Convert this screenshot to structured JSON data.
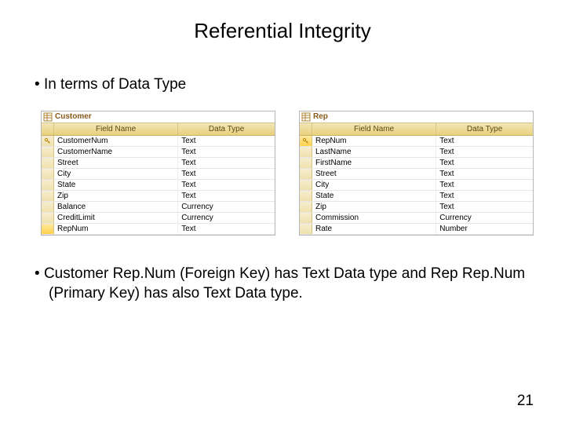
{
  "title": "Referential Integrity",
  "bullet1": "In terms of Data Type",
  "bullet2": "Customer Rep.Num (Foreign Key) has Text Data type and Rep Rep.Num (Primary Key) has also Text Data type.",
  "page_number": "21",
  "table_left": {
    "tab": "Customer",
    "header_field": "Field Name",
    "header_type": "Data Type",
    "rows": [
      {
        "pk": true,
        "sel": false,
        "field": "CustomerNum",
        "type": "Text"
      },
      {
        "pk": false,
        "sel": false,
        "field": "CustomerName",
        "type": "Text"
      },
      {
        "pk": false,
        "sel": false,
        "field": "Street",
        "type": "Text"
      },
      {
        "pk": false,
        "sel": false,
        "field": "City",
        "type": "Text"
      },
      {
        "pk": false,
        "sel": false,
        "field": "State",
        "type": "Text"
      },
      {
        "pk": false,
        "sel": false,
        "field": "Zip",
        "type": "Text"
      },
      {
        "pk": false,
        "sel": false,
        "field": "Balance",
        "type": "Currency"
      },
      {
        "pk": false,
        "sel": false,
        "field": "CreditLimit",
        "type": "Currency"
      },
      {
        "pk": false,
        "sel": true,
        "field": "RepNum",
        "type": "Text"
      }
    ]
  },
  "table_right": {
    "tab": "Rep",
    "header_field": "Field Name",
    "header_type": "Data Type",
    "rows": [
      {
        "pk": true,
        "sel": true,
        "field": "RepNum",
        "type": "Text"
      },
      {
        "pk": false,
        "sel": false,
        "field": "LastName",
        "type": "Text"
      },
      {
        "pk": false,
        "sel": false,
        "field": "FirstName",
        "type": "Text"
      },
      {
        "pk": false,
        "sel": false,
        "field": "Street",
        "type": "Text"
      },
      {
        "pk": false,
        "sel": false,
        "field": "City",
        "type": "Text"
      },
      {
        "pk": false,
        "sel": false,
        "field": "State",
        "type": "Text"
      },
      {
        "pk": false,
        "sel": false,
        "field": "Zip",
        "type": "Text"
      },
      {
        "pk": false,
        "sel": false,
        "field": "Commission",
        "type": "Currency"
      },
      {
        "pk": false,
        "sel": false,
        "field": "Rate",
        "type": "Number"
      }
    ]
  }
}
